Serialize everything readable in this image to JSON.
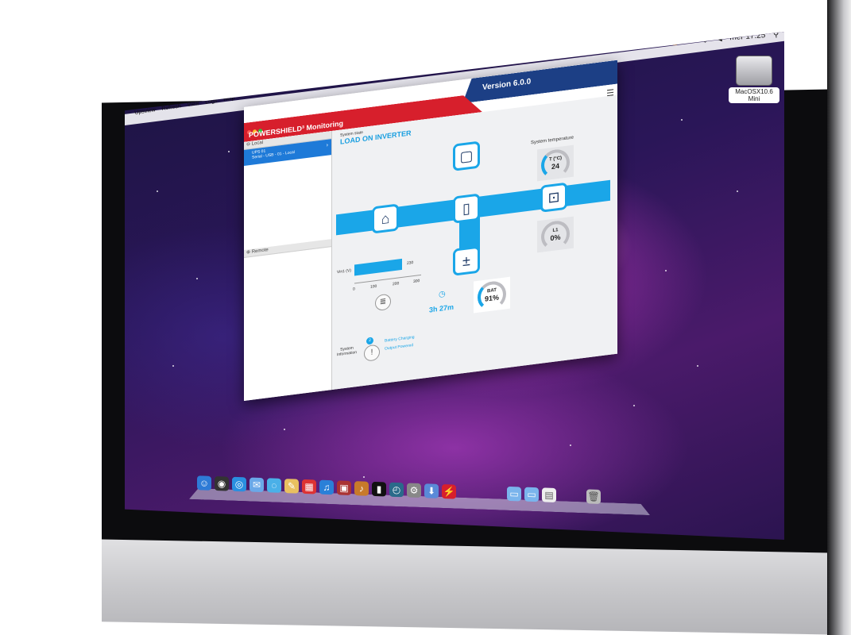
{
  "menubar": {
    "apple": "",
    "items": [
      "Upsview",
      "Refresh",
      "View",
      "Logs",
      "Help"
    ],
    "status": [
      "⌚",
      "✻",
      "◇",
      "◀"
    ],
    "clock": "mer 17.25",
    "search_icon": "search-icon"
  },
  "desktop": {
    "drive_label": "MacOSX10.6\nMini"
  },
  "app": {
    "title": "POWERSHIELD³ Monitoring",
    "version": "Version 6.0.0",
    "menu_icon": "☰",
    "sidebar": {
      "local_label": "Local",
      "ups_name": "UPS 01",
      "ups_detail": "Serial - USB - 01 - Local",
      "remote_label": "Remote"
    },
    "state_label": "System state",
    "state_value": "LOAD ON INVERTER",
    "temperature_title": "System temperature",
    "temperature_unit": "T (°C)",
    "temperature_value": "24",
    "load_label": "L1",
    "load_value": "0%",
    "vin_label": "Vin1 (V)",
    "vin_value": "230",
    "vin_fraction": 0.77,
    "axis_ticks": [
      "0",
      "100",
      "200",
      "300"
    ],
    "runtime": "3h 27m",
    "battery_label": "BAT",
    "battery_value": "91%",
    "system_info_label": "System\nInformation",
    "info_badge": "2",
    "info_lines": [
      "Battery Charging",
      "Output Powered"
    ]
  },
  "colors": {
    "accent_blue": "#1aa6e8",
    "header_red": "#d71f2c",
    "header_navy": "#1c3f85"
  }
}
